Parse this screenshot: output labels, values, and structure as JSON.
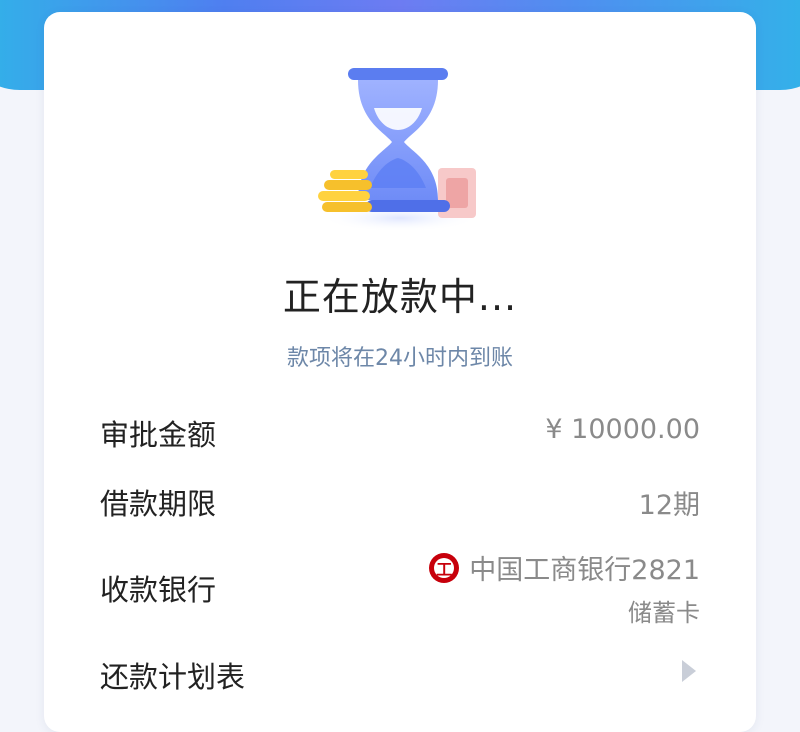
{
  "status": {
    "title": "正在放款中...",
    "subtitle": "款项将在24小时内到账"
  },
  "details": {
    "approved_amount_label": "审批金额",
    "approved_amount_value": "¥ 10000.00",
    "term_label": "借款期限",
    "term_value": "12期",
    "bank_label": "收款银行",
    "bank_name": "中国工商银行2821",
    "bank_card_type": "储蓄卡",
    "schedule_label": "还款计划表"
  },
  "icons": {
    "illustration": "hourglass-with-coins-illustration",
    "bank_logo": "icbc-logo-icon",
    "arrow": "chevron-right-icon"
  },
  "colors": {
    "header_gradient_start": "#2fb6e8",
    "header_gradient_mid": "#6d7cf2",
    "subtitle": "#6d87a8",
    "bank_logo": "#c7000b"
  }
}
